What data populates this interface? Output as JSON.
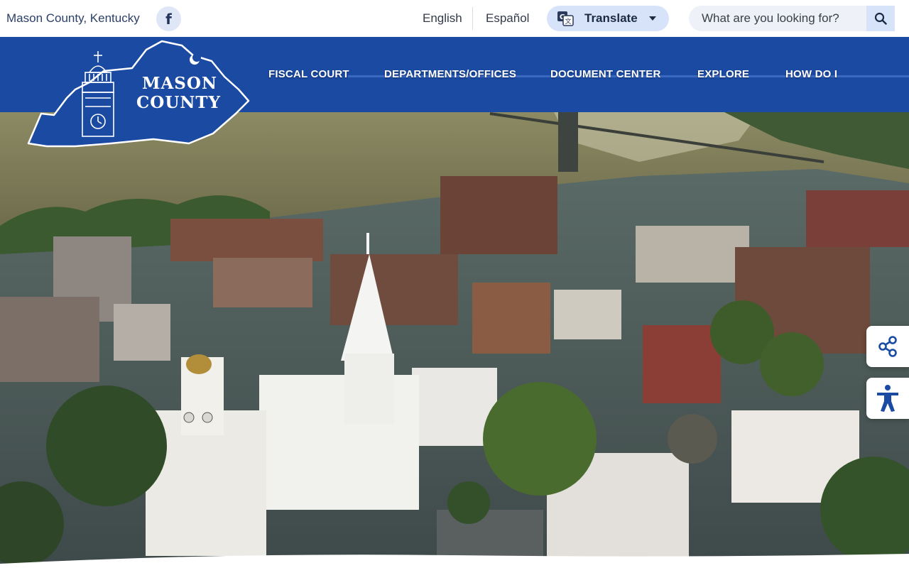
{
  "topbar": {
    "site_name": "Mason County, Kentucky",
    "facebook_glyph": "f",
    "lang_english": "English",
    "lang_spanish": "Español",
    "translate_label": "Translate",
    "search_placeholder": "What are you looking for?"
  },
  "logo": {
    "line1": "MASON",
    "line2": "COUNTY"
  },
  "nav": {
    "items": [
      {
        "label": "FISCAL COURT"
      },
      {
        "label": "DEPARTMENTS/OFFICES"
      },
      {
        "label": "DOCUMENT CENTER"
      },
      {
        "label": "EXPLORE"
      },
      {
        "label": "HOW DO I"
      }
    ]
  },
  "icons": {
    "facebook": "facebook-icon",
    "translate": "translate-icon",
    "search": "search-icon",
    "share": "share-icon",
    "accessibility": "accessibility-icon"
  },
  "colors": {
    "brand_blue": "#1b4aa3",
    "pill_blue": "#d7e3f8",
    "text_dark": "#2b3f66"
  }
}
